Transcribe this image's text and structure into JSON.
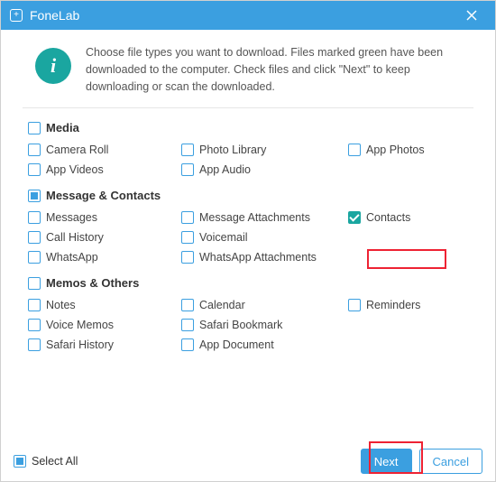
{
  "titlebar": {
    "title": "FoneLab"
  },
  "intro": {
    "text": "Choose file types you want to download. Files marked green have been downloaded to the computer. Check files and click \"Next\" to keep downloading or scan the downloaded."
  },
  "sections": {
    "media": {
      "label": "Media",
      "items": [
        {
          "label": "Camera Roll"
        },
        {
          "label": "Photo Library"
        },
        {
          "label": "App Photos"
        },
        {
          "label": "App Videos"
        },
        {
          "label": "App Audio"
        }
      ]
    },
    "messages": {
      "label": "Message & Contacts",
      "items": [
        {
          "label": "Messages"
        },
        {
          "label": "Message Attachments"
        },
        {
          "label": "Contacts"
        },
        {
          "label": "Call History"
        },
        {
          "label": "Voicemail"
        },
        {
          "label": "WhatsApp"
        },
        {
          "label": "WhatsApp Attachments"
        }
      ]
    },
    "memos": {
      "label": "Memos & Others",
      "items": [
        {
          "label": "Notes"
        },
        {
          "label": "Calendar"
        },
        {
          "label": "Reminders"
        },
        {
          "label": "Voice Memos"
        },
        {
          "label": "Safari Bookmark"
        },
        {
          "label": "Safari History"
        },
        {
          "label": "App Document"
        }
      ]
    }
  },
  "footer": {
    "select_all": "Select All",
    "next": "Next",
    "cancel": "Cancel"
  }
}
